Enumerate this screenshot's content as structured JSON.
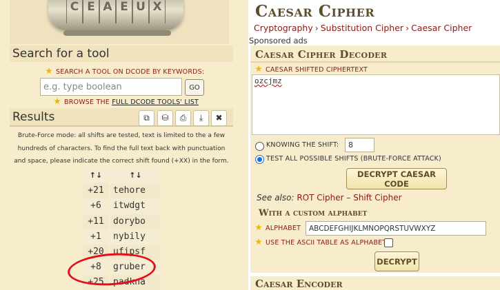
{
  "hero": {
    "cylinder_letters": [
      "C",
      "E",
      "A",
      "E",
      "U",
      "X"
    ]
  },
  "search": {
    "heading": "Search for a tool",
    "label": "SEARCH A TOOL ON DCODE BY KEYWORDS:",
    "placeholder": "e.g. type boolean",
    "go_label": "GO",
    "browse_prefix": "BROWSE THE",
    "browse_link": "FULL DCODE TOOLS' LIST"
  },
  "results": {
    "heading": "Results",
    "toolbar_icons": [
      "copy-icon",
      "save-icon",
      "print-icon",
      "download-icon",
      "close-icon"
    ],
    "toolbar_glyphs": [
      "⧉",
      "⛁",
      "⎙",
      "⤓",
      "✖"
    ],
    "note": "Brute-Force mode: all shifts are tested, text is limited to the a few hundreds of characters. To find the full text back with punctuation and space, please indicate the correct shift found (+XX) in the form.",
    "columns": [
      "↑↓",
      "↑↓"
    ],
    "rows": [
      {
        "shift": "+21",
        "text": "tehore"
      },
      {
        "shift": "+6",
        "text": "itwdgt"
      },
      {
        "shift": "+11",
        "text": "dorybo"
      },
      {
        "shift": "+1",
        "text": "nybily"
      },
      {
        "shift": "+20",
        "text": "ufipsf"
      },
      {
        "shift": "+8",
        "text": "gruber"
      },
      {
        "shift": "+25",
        "text": "padkna"
      }
    ]
  },
  "page": {
    "title": "Caesar Cipher",
    "breadcrumb": [
      "Cryptography",
      "Substitution Cipher",
      "Caesar Cipher"
    ],
    "breadcrumb_sep": "›",
    "sponsored": "Sponsored ads"
  },
  "decoder": {
    "title": "Caesar Cipher Decoder",
    "ciphertext_label": "CAESAR SHIFTED CIPHERTEXT",
    "ciphertext_value": "ozcjmz",
    "knowing_shift_label": "KNOWING THE SHIFT:",
    "shift_value": "8",
    "brute_force_label": "TEST ALL POSSIBLE SHIFTS (BRUTE-FORCE ATTACK)",
    "decrypt_button": "DECRYPT CAESAR CODE",
    "see_also_prefix": "See also:",
    "see_also_links": [
      "ROT Cipher",
      "Shift Cipher"
    ],
    "see_also_sep": "–",
    "custom_alphabet_title": "With a custom alphabet",
    "alphabet_label": "ALPHABET",
    "alphabet_value": "ABCDEFGHIJKLMNOPQRSTUVWXYZ",
    "ascii_label": "USE THE ASCII TABLE AS ALPHABET",
    "decrypt_short_button": "DECRYPT"
  },
  "encoder": {
    "title": "Caesar Encoder"
  },
  "colors": {
    "panel_bg": "#f7eccb",
    "title_brown": "#5e4c2b",
    "link_red": "#8a1a1a",
    "annotation_red": "#e3101c",
    "star_gold": "#f0b400"
  }
}
